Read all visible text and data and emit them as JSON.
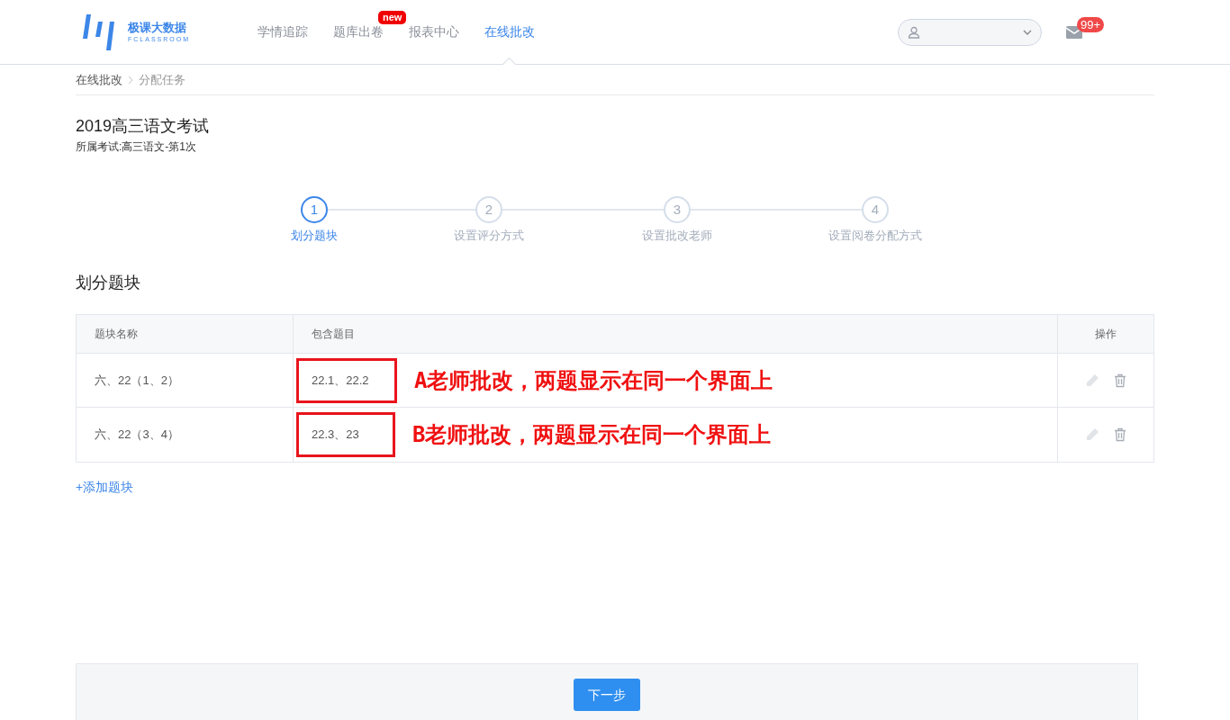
{
  "logo": {
    "name": "极课大数据",
    "subtitle": "FCLASSROOM"
  },
  "nav": [
    {
      "label": "学情追踪",
      "selected": false
    },
    {
      "label": "题库出卷",
      "selected": false,
      "badge": "new"
    },
    {
      "label": "报表中心",
      "selected": false
    },
    {
      "label": "在线批改",
      "selected": true
    }
  ],
  "mail_badge": "99+",
  "breadcrumb": [
    "在线批改",
    "分配任务"
  ],
  "exam": {
    "title": "2019高三语文考试",
    "subtitle": "所属考试:高三语文-第1次"
  },
  "steps": [
    {
      "number": "1",
      "label": "划分题块",
      "selected": true
    },
    {
      "number": "2",
      "label": "设置评分方式",
      "selected": false
    },
    {
      "number": "3",
      "label": "设置批改老师",
      "selected": false
    },
    {
      "number": "4",
      "label": "设置阅卷分配方式",
      "selected": false
    }
  ],
  "section_title": "划分题块",
  "table": {
    "columns": [
      "题块名称",
      "包含题目",
      "操作"
    ],
    "rows": [
      {
        "name": "六、22（1、2）",
        "questions": "22.1、22.2",
        "annotation": "A老师批改，两题显示在同一个界面上"
      },
      {
        "name": "六、22（3、4）",
        "questions": "22.3、23",
        "annotation": "B老师批改，两题显示在同一个界面上"
      }
    ]
  },
  "add_link": "+添加题块",
  "next_button": "下一步"
}
